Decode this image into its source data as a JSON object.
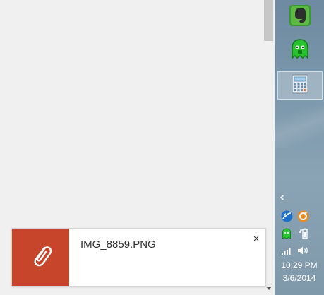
{
  "download": {
    "filename": "IMG_8859.PNG",
    "close_glyph": "×",
    "icon": "paperclip-icon",
    "accent": "#c7452a"
  },
  "taskbar": {
    "pinned": [
      {
        "name": "evernote",
        "icon": "evernote-icon",
        "active": false
      },
      {
        "name": "vpn",
        "icon": "vpn-ghost-icon",
        "active": false
      },
      {
        "name": "calculator",
        "icon": "calculator-icon",
        "active": true
      }
    ],
    "tray_icons": [
      "chevron-up-icon",
      "map-icon",
      "orange-sync-icon",
      "vpn-ghost-icon",
      "battery-icon",
      "signal-icon",
      "volume-icon"
    ]
  },
  "clock": {
    "time": "10:29 PM",
    "date": "3/6/2014"
  },
  "colors": {
    "taskbar": "#7b97ab",
    "page": "#f0f0f0"
  }
}
